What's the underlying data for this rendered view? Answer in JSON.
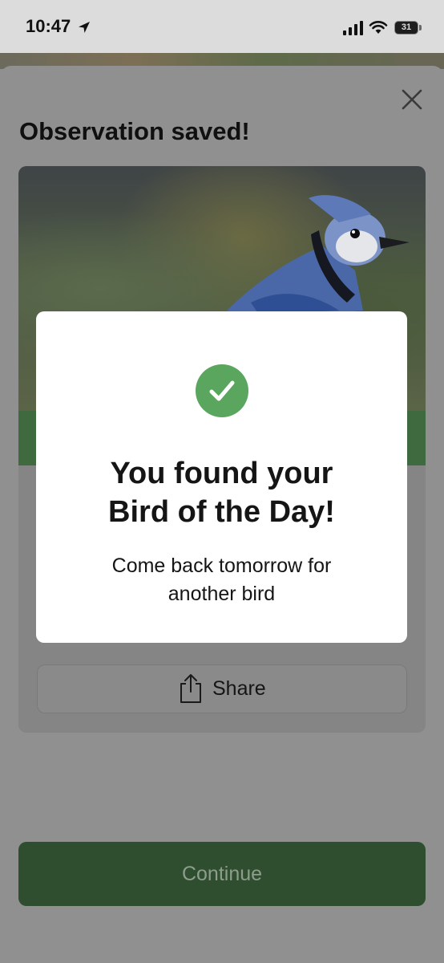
{
  "status_bar": {
    "time": "10:47",
    "battery": "31"
  },
  "sheet": {
    "title": "Observation saved!"
  },
  "card": {
    "share_label": "Share"
  },
  "modal": {
    "title_line1": "You found your",
    "title_line2": "Bird of the Day!",
    "subtitle_line1": "Come back tomorrow for",
    "subtitle_line2": "another bird"
  },
  "footer": {
    "continue_label": "Continue"
  },
  "colors": {
    "accent_green": "#5aa65f",
    "continue_bg": "#2f4e30",
    "modal_bg": "#ffffff"
  },
  "icons": [
    "location-arrow-icon",
    "signal-icon",
    "wifi-icon",
    "battery-icon",
    "close-icon",
    "share-icon",
    "checkmark-icon"
  ]
}
